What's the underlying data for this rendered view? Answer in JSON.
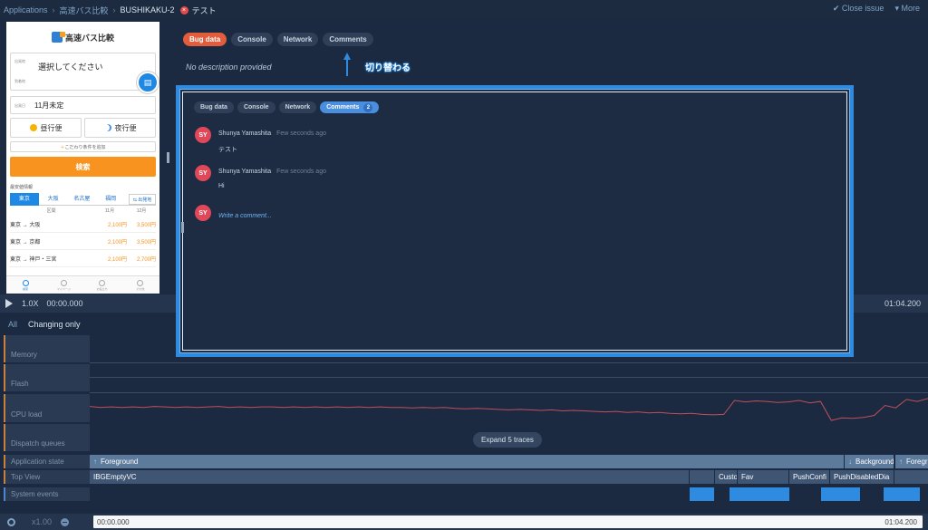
{
  "breadcrumb": {
    "items": [
      "Applications",
      "高速バス比較",
      "BUSHIKAKU-2"
    ],
    "issue_title": "テスト",
    "error_badge": "×"
  },
  "header_actions": {
    "close_issue": "Close issue",
    "more": "More"
  },
  "tabs": [
    "Bug data",
    "Console",
    "Network",
    "Comments"
  ],
  "no_description": "No description provided",
  "annotation": "切り替わる",
  "phone": {
    "logo": "高速バス比較",
    "from_label": "出発地",
    "to_label": "到着地",
    "route_placeholder": "選択してください",
    "date_label": "出発日",
    "date_value": "11月未定",
    "day_bus": "昼行便",
    "night_bus": "夜行便",
    "conditions": "こだわり条件を追加",
    "search": "検索",
    "section": "最安値情報",
    "regions": [
      "東京",
      "大阪",
      "名古屋",
      "福岡"
    ],
    "fix_button": "出発地",
    "table_header": [
      "区間",
      "11月",
      "12月"
    ],
    "rows": [
      {
        "route": "東京 → 大阪",
        "nov": "2,100円",
        "dec": "3,500円"
      },
      {
        "route": "東京 → 京都",
        "nov": "2,100円",
        "dec": "3,500円"
      },
      {
        "route": "東京 → 神戸・三宮",
        "nov": "2,100円",
        "dec": "2,700円"
      }
    ],
    "nav": [
      "検索",
      "マイページ",
      "お役立ち",
      "その他"
    ]
  },
  "playback": {
    "speed": "1.0X",
    "time_start": "00:00.000",
    "time_end": "01:04.200"
  },
  "filters": {
    "all": "All",
    "changing": "Changing only"
  },
  "trace_labels": [
    "Memory",
    "Flash",
    "CPU load",
    "Dispatch queues",
    "Application state",
    "Top View",
    "System events"
  ],
  "expand_label": "Expand 5 traces",
  "app_state": [
    {
      "label": "Foreground",
      "arrow": "↑"
    },
    {
      "label": "Background",
      "arrow": "↓"
    },
    {
      "label": "Foreground",
      "arrow": "↑"
    }
  ],
  "top_view": [
    "IBGEmptyVC",
    "",
    "Custom",
    "Fav",
    "",
    "PushConfi",
    "PushDisabledDia",
    ""
  ],
  "bottom": {
    "zoom": "x1.00",
    "time_start": "00:00.000",
    "time_end": "01:04.200"
  },
  "comments_panel": {
    "tabs": [
      "Bug data",
      "Console",
      "Network",
      "Comments"
    ],
    "count": "2",
    "comments": [
      {
        "initials": "SY",
        "author": "Shunya Yamashita",
        "time": "Few seconds ago",
        "text": "テスト"
      },
      {
        "initials": "SY",
        "author": "Shunya Yamashita",
        "time": "Few seconds ago",
        "text": "Hi"
      }
    ],
    "composer_initials": "SY",
    "composer_placeholder": "Write a comment..."
  },
  "cpu_series": [
    48,
    46,
    47,
    46,
    47,
    46,
    48,
    47,
    46,
    47,
    46,
    47,
    48,
    46,
    47,
    46,
    47,
    47,
    46,
    47,
    46,
    47,
    46,
    47,
    46,
    47,
    46,
    47,
    46,
    46,
    45,
    46,
    45,
    46,
    44,
    43,
    44,
    43,
    42,
    41,
    42,
    41,
    40,
    41,
    39,
    40,
    39,
    38,
    37,
    38,
    36,
    37,
    35,
    36,
    34,
    33,
    34,
    32,
    31,
    32,
    60,
    57,
    59,
    58,
    56,
    57,
    60,
    55,
    58,
    20,
    25,
    24,
    26,
    30,
    50,
    45,
    62,
    58,
    64
  ]
}
